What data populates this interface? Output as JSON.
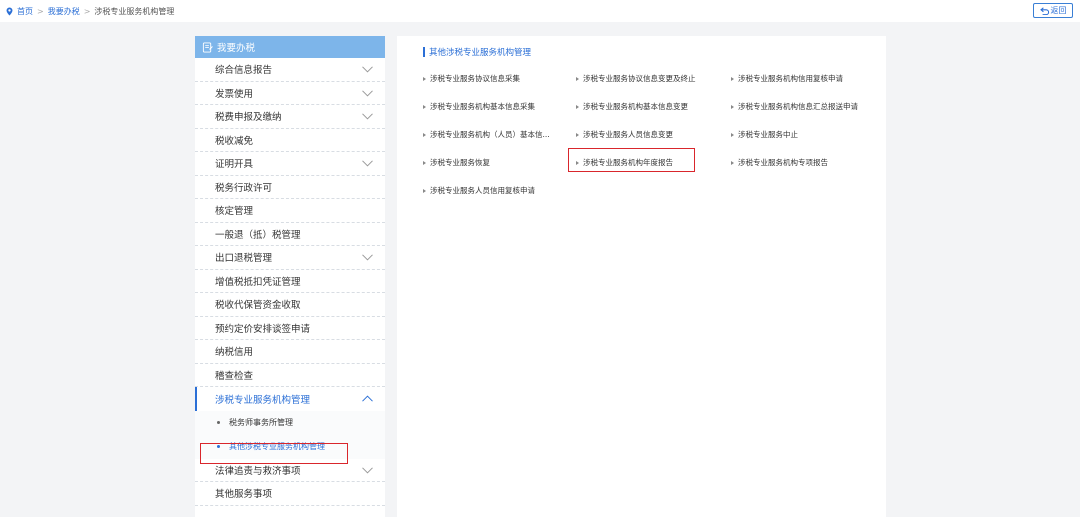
{
  "breadcrumb": {
    "items": [
      {
        "label": "首页"
      },
      {
        "label": "我要办税"
      },
      {
        "label": "涉税专业服务机构管理"
      }
    ],
    "separator": ">"
  },
  "back_button": {
    "label": "返回"
  },
  "sidebar": {
    "title": "我要办税",
    "items": [
      {
        "label": "综合信息报告",
        "expandable": true
      },
      {
        "label": "发票使用",
        "expandable": true
      },
      {
        "label": "税费申报及缴纳",
        "expandable": true
      },
      {
        "label": "税收减免",
        "expandable": false
      },
      {
        "label": "证明开具",
        "expandable": true
      },
      {
        "label": "税务行政许可",
        "expandable": false
      },
      {
        "label": "核定管理",
        "expandable": false
      },
      {
        "label": "一般退（抵）税管理",
        "expandable": false
      },
      {
        "label": "出口退税管理",
        "expandable": true
      },
      {
        "label": "增值税抵扣凭证管理",
        "expandable": false
      },
      {
        "label": "税收代保管资金收取",
        "expandable": false
      },
      {
        "label": "预约定价安排谈签申请",
        "expandable": false
      },
      {
        "label": "纳税信用",
        "expandable": false
      },
      {
        "label": "稽查检查",
        "expandable": false
      },
      {
        "label": "涉税专业服务机构管理",
        "expandable": true,
        "expanded": true,
        "active": true
      },
      {
        "label": "法律追责与救济事项",
        "expandable": true
      },
      {
        "label": "其他服务事项",
        "expandable": false
      }
    ],
    "sub_items": [
      {
        "label": "税务师事务所管理",
        "selected": false
      },
      {
        "label": "其他涉税专业服务机构管理",
        "selected": true
      }
    ]
  },
  "panel": {
    "title": "其他涉税专业服务机构管理",
    "links": [
      {
        "label": "涉税专业服务协议信息采集"
      },
      {
        "label": "涉税专业服务协议信息变更及终止"
      },
      {
        "label": "涉税专业服务机构信用复核申请"
      },
      {
        "label": "涉税专业服务机构基本信息采集"
      },
      {
        "label": "涉税专业服务机构基本信息变更"
      },
      {
        "label": "涉税专业服务机构信息汇总报送申请"
      },
      {
        "label": "涉税专业服务机构（人员）基本信..."
      },
      {
        "label": "涉税专业服务人员信息变更"
      },
      {
        "label": "涉税专业服务中止"
      },
      {
        "label": "涉税专业服务恢复"
      },
      {
        "label": "涉税专业服务机构年度报告",
        "highlighted": true
      },
      {
        "label": "涉税专业服务机构专项报告"
      },
      {
        "label": "涉税专业服务人员信用复核申请"
      }
    ]
  },
  "colors": {
    "accent": "#2b6fd6",
    "sidebar_header": "#7db5ea",
    "highlight_box": "#d9262c"
  }
}
